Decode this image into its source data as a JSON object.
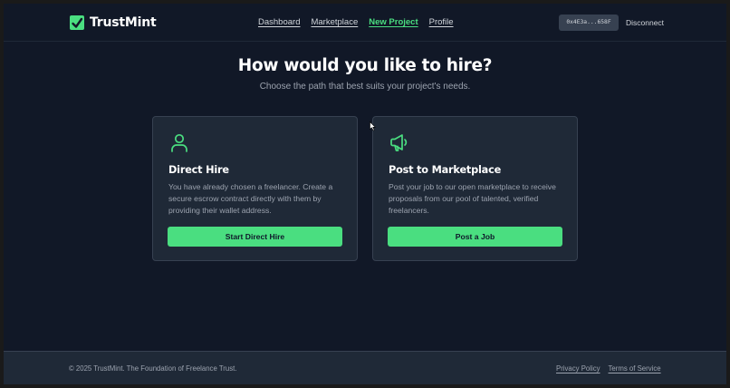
{
  "header": {
    "logo_text": "TrustMint",
    "nav": [
      {
        "label": "Dashboard"
      },
      {
        "label": "Marketplace"
      },
      {
        "label": "New Project",
        "active": true
      },
      {
        "label": "Profile"
      }
    ],
    "wallet_address": "0x4E3a...658F",
    "disconnect_label": "Disconnect"
  },
  "main": {
    "title": "How would you like to hire?",
    "subtitle": "Choose the path that best suits your project's needs.",
    "cards": [
      {
        "icon": "user-icon",
        "title": "Direct Hire",
        "description": "You have already chosen a freelancer. Create a secure escrow contract directly with them by providing their wallet address.",
        "button": "Start Direct Hire"
      },
      {
        "icon": "megaphone-icon",
        "title": "Post to Marketplace",
        "description": "Post your job to our open marketplace to receive proposals from our pool of talented, verified freelancers.",
        "button": "Post a Job"
      }
    ]
  },
  "footer": {
    "copyright": "© 2025 TrustMint. The Foundation of Freelance Trust.",
    "links": [
      {
        "label": "Privacy Policy"
      },
      {
        "label": "Terms of Service"
      }
    ]
  },
  "colors": {
    "background": "#111827",
    "card": "#1f2937",
    "accent": "#4ade80",
    "text_muted": "#9ca3af"
  }
}
